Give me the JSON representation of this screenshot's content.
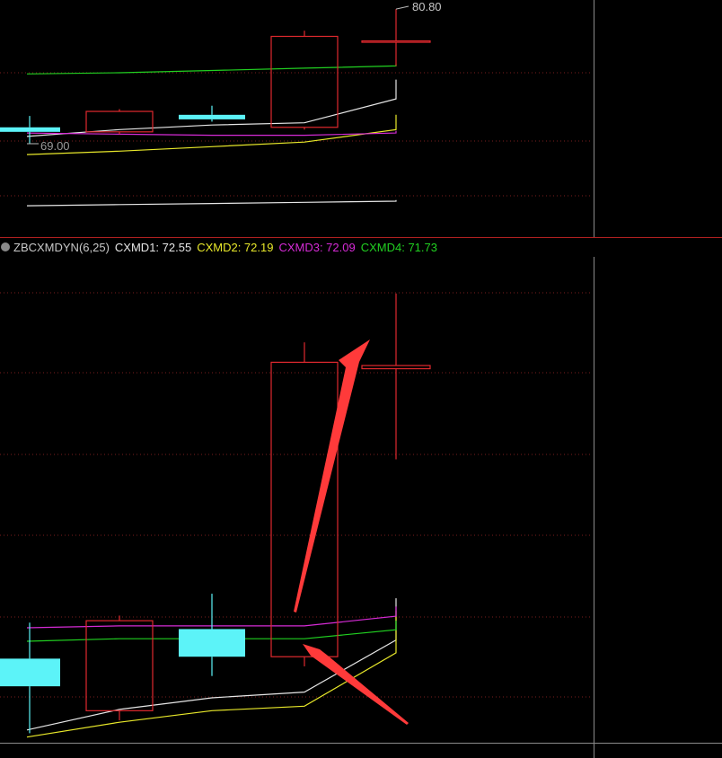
{
  "colors": {
    "background": "#000000",
    "grid": "#7a1e1e",
    "border": "#b02020",
    "up_candle": "#e0292e",
    "down_candle": "#5cf3f8",
    "cxmd1": "#e6e6e6",
    "cxmd2": "#e8e82a",
    "cxmd3": "#d62bd6",
    "cxmd4": "#21d021",
    "arrow": "#ff3a3a",
    "label_text": "#c8c8c8"
  },
  "indicator_header": {
    "icon": "gear-icon",
    "name": "ZBCXMDYN(6,25)",
    "cxmd1": "CXMD1: 72.55",
    "cxmd2": "CXMD2: 72.19",
    "cxmd3": "CXMD3: 72.09",
    "cxmd4": "CXMD4: 71.73"
  },
  "chart_data": [
    {
      "type": "candlestick",
      "name": "price-panel",
      "annotations": {
        "high_label": "80.80",
        "low_label": "69.00"
      },
      "candles": [
        {
          "open": 70.4,
          "close": 70.0,
          "high": 71.4,
          "low": 69.0,
          "color": "down"
        },
        {
          "open": 70.0,
          "close": 71.8,
          "high": 72.0,
          "low": 69.8,
          "color": "up"
        },
        {
          "open": 71.5,
          "close": 71.1,
          "high": 72.3,
          "low": 70.9,
          "color": "down"
        },
        {
          "open": 70.4,
          "close": 78.4,
          "high": 78.9,
          "low": 70.2,
          "color": "up"
        },
        {
          "open": 78.0,
          "close": 77.9,
          "high": 80.8,
          "low": 75.8,
          "color": "up"
        }
      ],
      "lines": [
        {
          "name": "white",
          "values": [
            69.6,
            70.2,
            70.6,
            70.8,
            72.9,
            74.6
          ]
        },
        {
          "name": "green",
          "values": [
            75.1,
            75.2,
            75.4,
            75.6,
            75.8,
            76.0
          ]
        },
        {
          "name": "yellow",
          "values": [
            68.0,
            68.3,
            68.7,
            69.1,
            70.2,
            71.5
          ]
        },
        {
          "name": "magenta",
          "values": [
            69.9,
            69.8,
            69.7,
            69.7,
            69.9,
            70.1
          ]
        },
        {
          "name": "white-lower",
          "values": [
            63.5,
            63.6,
            63.7,
            63.8,
            63.9,
            64.0
          ]
        }
      ]
    },
    {
      "type": "candlestick",
      "name": "ZBCXMDYN",
      "candles": [
        {
          "open": 67.55,
          "close": 67.12,
          "high": 68.11,
          "low": 66.39,
          "color": "down"
        },
        {
          "open": 66.74,
          "close": 68.14,
          "high": 68.22,
          "low": 66.59,
          "color": "up"
        },
        {
          "open": 68.01,
          "close": 67.58,
          "high": 68.56,
          "low": 67.28,
          "color": "down"
        },
        {
          "open": 67.58,
          "close": 72.16,
          "high": 72.47,
          "low": 67.43,
          "color": "up"
        },
        {
          "open": 72.11,
          "close": 72.06,
          "high": 73.23,
          "low": 70.65,
          "color": "up"
        }
      ],
      "lines": [
        {
          "name": "CXMD1",
          "values": [
            66.44,
            66.76,
            66.94,
            67.03,
            67.84,
            68.49
          ]
        },
        {
          "name": "CXMD2",
          "values": [
            66.33,
            66.56,
            66.74,
            66.81,
            67.64,
            68.3
          ]
        },
        {
          "name": "CXMD3",
          "values": [
            68.03,
            68.06,
            68.06,
            68.06,
            68.21,
            68.36
          ]
        },
        {
          "name": "CXMD4",
          "values": [
            67.82,
            67.86,
            67.86,
            67.86,
            68.0,
            68.14
          ]
        }
      ],
      "ylim": [
        66.2,
        73.8
      ],
      "arrows": 2
    }
  ]
}
